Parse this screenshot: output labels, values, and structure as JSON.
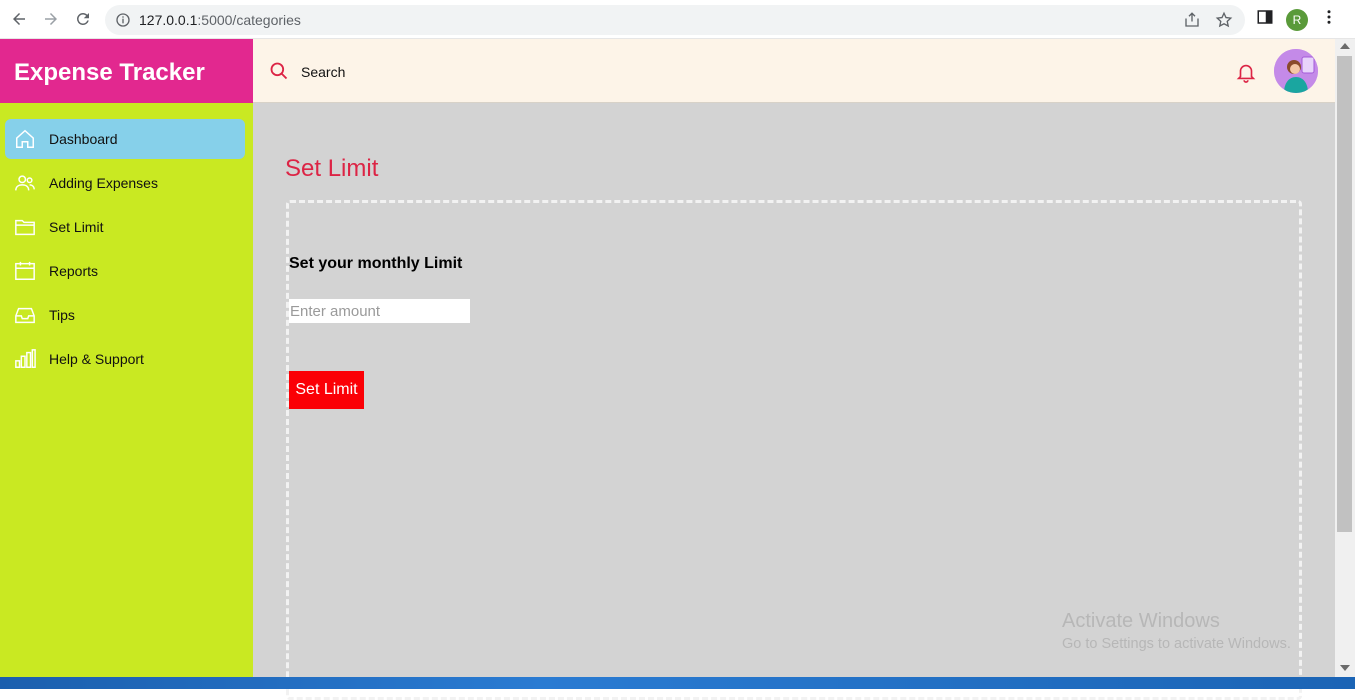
{
  "browser": {
    "url_host": "127.0.0.1",
    "url_path": ":5000/categories",
    "profile_initial": "R"
  },
  "sidebar": {
    "brand": "Expense Tracker",
    "items": [
      {
        "label": "Dashboard",
        "icon": "home-icon",
        "active": true
      },
      {
        "label": "Adding Expenses",
        "icon": "users-icon",
        "active": false
      },
      {
        "label": "Set Limit",
        "icon": "folder-icon",
        "active": false
      },
      {
        "label": "Reports",
        "icon": "calendar-icon",
        "active": false
      },
      {
        "label": "Tips",
        "icon": "inbox-icon",
        "active": false
      },
      {
        "label": "Help & Support",
        "icon": "bar-chart-icon",
        "active": false
      }
    ]
  },
  "header": {
    "search_label": "Search"
  },
  "main": {
    "title": "Set Limit",
    "form_heading": "Set your monthly Limit",
    "amount_placeholder": "Enter amount",
    "amount_value": "",
    "submit_label": "Set Limit"
  },
  "watermark": {
    "title": "Activate Windows",
    "subtitle": "Go to Settings to activate Windows."
  },
  "colors": {
    "brand": "#e2288f",
    "sidebar": "#c9e922",
    "active_item": "#86d0ea",
    "title": "#dc2445",
    "button": "#fb0006"
  }
}
